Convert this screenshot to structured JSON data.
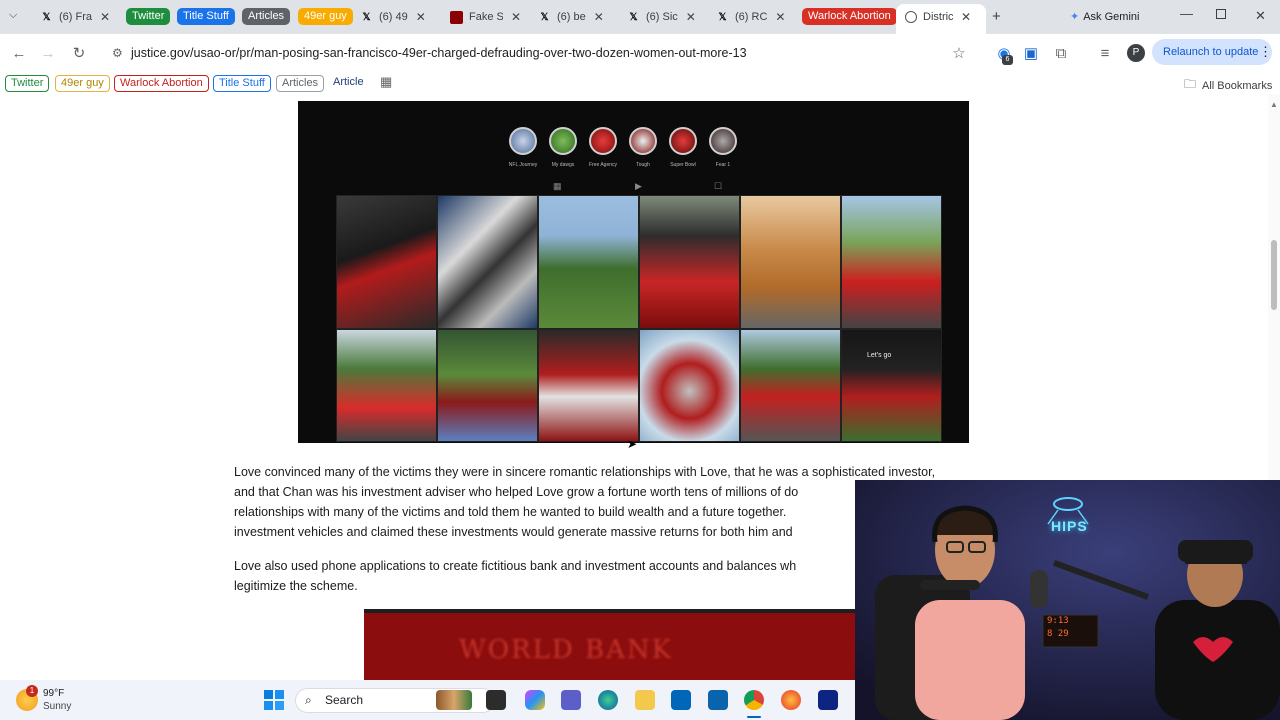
{
  "browser": {
    "tabs": [
      {
        "label": "(6) Fra",
        "kind": "x"
      },
      {
        "label": "(6) 49",
        "kind": "x"
      },
      {
        "label": "Fake S",
        "kind": "red"
      },
      {
        "label": "(6) be",
        "kind": "x"
      },
      {
        "label": "(6) Sic",
        "kind": "x"
      },
      {
        "label": "(6) RC",
        "kind": "x"
      },
      {
        "label": "Distric",
        "kind": "active"
      }
    ],
    "tab_groups": [
      {
        "label": "Twitter",
        "color": "#1e8e3e"
      },
      {
        "label": "Title Stuff",
        "color": "#1a73e8"
      },
      {
        "label": "Articles",
        "color": "#5f6368"
      },
      {
        "label": "49er guy",
        "color": "#f9ab00"
      },
      {
        "label": "Warlock Abortion",
        "color": "#d93025"
      }
    ],
    "ask_gemini": "Ask Gemini",
    "url": "justice.gov/usao-or/pr/man-posing-san-francisco-49er-charged-defrauding-over-two-dozen-women-out-more-13",
    "relaunch_label": "Relaunch to update",
    "profile_initial": "P",
    "extension_badge": "6"
  },
  "bookmarks": {
    "items": [
      {
        "label": "Twitter",
        "color": "#1e8e3e"
      },
      {
        "label": "49er guy",
        "color": "#b08600"
      },
      {
        "label": "Warlock Abortion",
        "color": "#c5221f"
      },
      {
        "label": "Title Stuff",
        "color": "#1a73e8"
      },
      {
        "label": "Articles",
        "color": "#5f6368"
      }
    ],
    "plain": "Article",
    "all_bookmarks": "All Bookmarks"
  },
  "hero_image": {
    "stories": [
      "NFL Journey",
      "My dawgs",
      "Free Agency",
      "Tough",
      "Super Bowl",
      "Fear 1"
    ],
    "caption_tile": "Let's go"
  },
  "article": {
    "para1": [
      "Love convinced many of the victims they were in sincere romantic relationships with Love, that he was a sophisticated investor,",
      "and that Chan was his investment adviser who helped Love grow a fortune worth tens of millions of do",
      "relationships with many of the victims and told them he wanted to build wealth and a future together.",
      "investment vehicles and claimed these investments would generate massive returns for both him and"
    ],
    "para2": [
      "Love also used phone applications to create fictitious bank and investment accounts and balances wh",
      "legitimize the scheme."
    ],
    "image2_text": "WORLD BANK"
  },
  "webcam": {
    "neon_sign": "HIPS",
    "clock_line1": "9:13",
    "clock_line2": "8 29"
  },
  "taskbar": {
    "weather_temp": "99°F",
    "weather_desc": "Sunny",
    "weather_badge": "1",
    "search_placeholder": "Search"
  }
}
